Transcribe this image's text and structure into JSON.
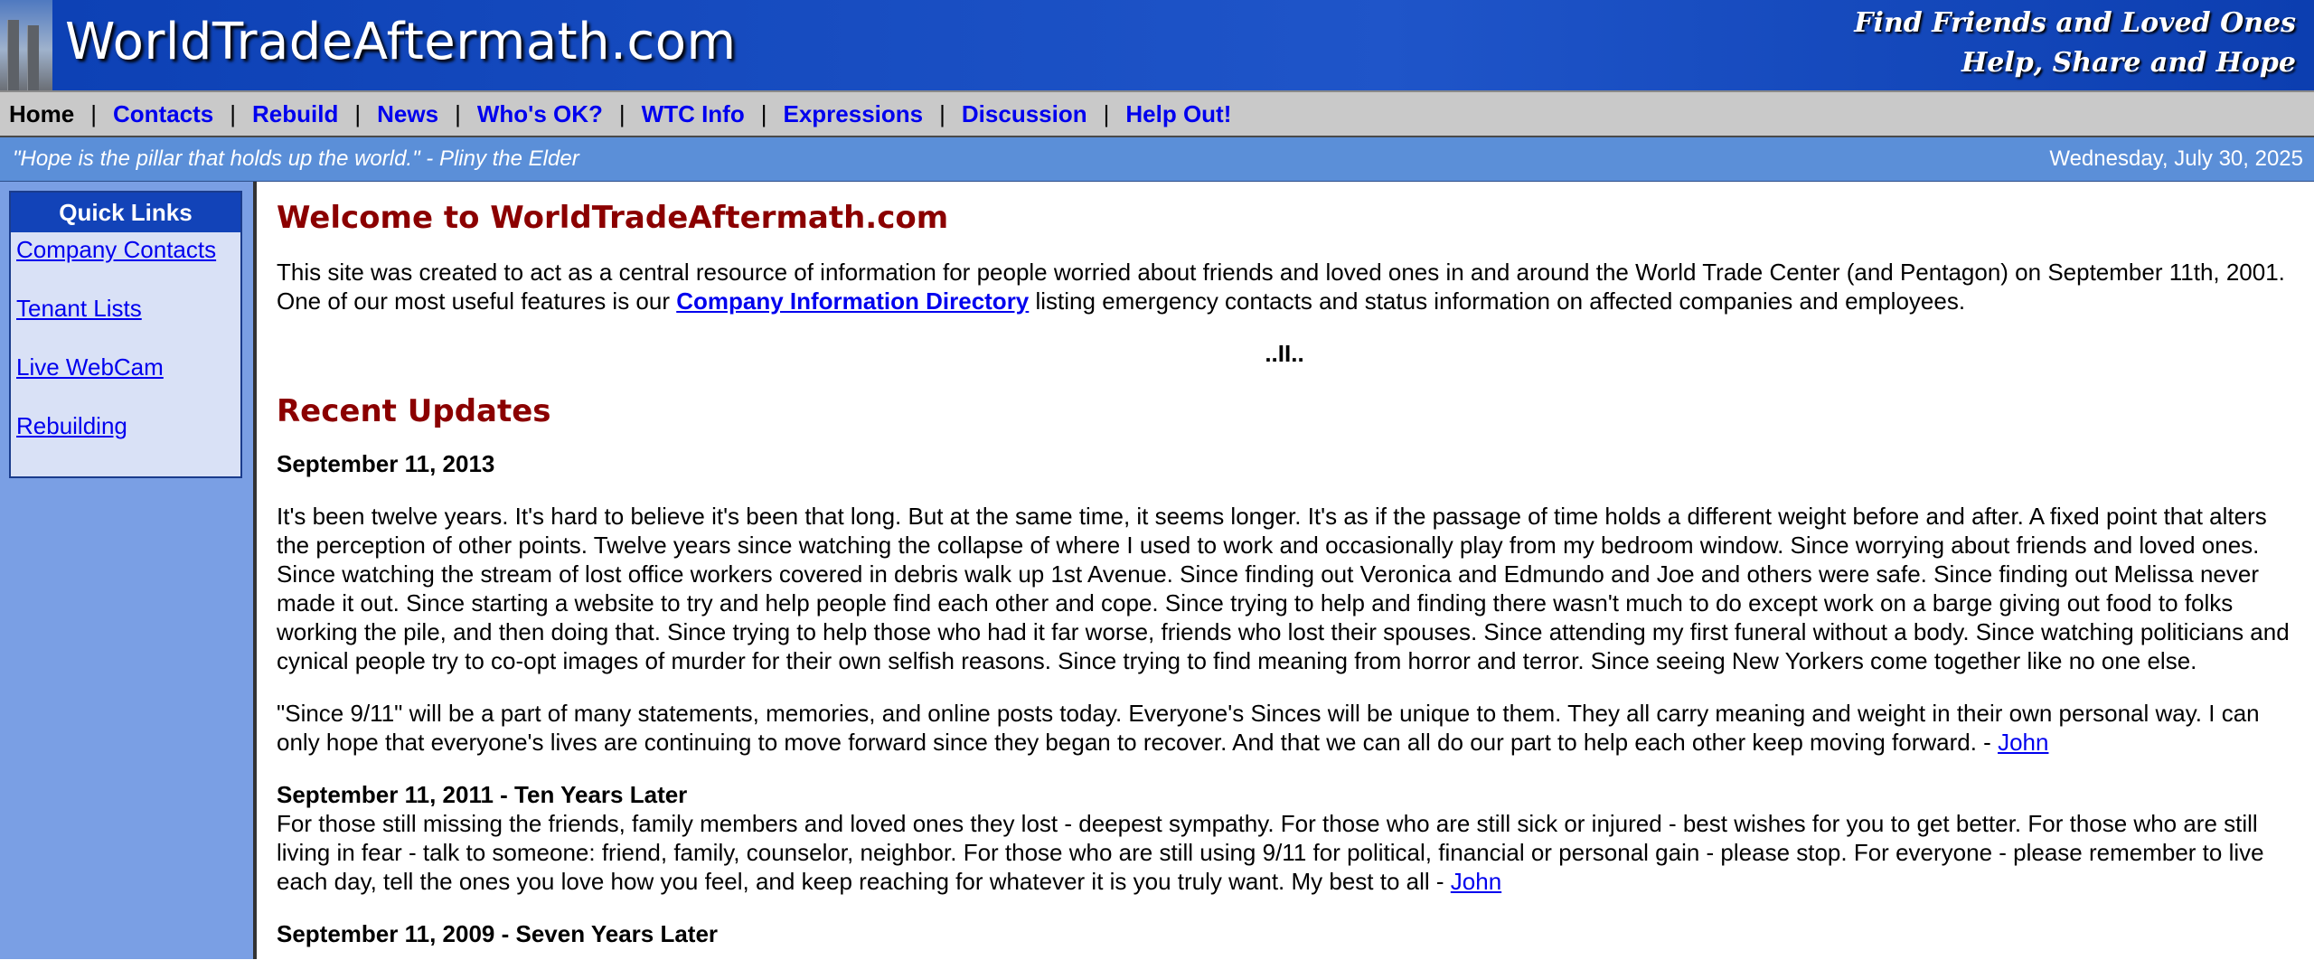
{
  "header": {
    "logo_text": "WorldTradeAftermath.com",
    "tagline_line1": "Find Friends and Loved Ones",
    "tagline_line2": "Help, Share and Hope"
  },
  "nav": {
    "items": [
      {
        "label": "Home"
      },
      {
        "label": "Contacts"
      },
      {
        "label": "Rebuild"
      },
      {
        "label": "News"
      },
      {
        "label": "Who's OK?"
      },
      {
        "label": "WTC Info"
      },
      {
        "label": "Expressions"
      },
      {
        "label": "Discussion"
      },
      {
        "label": "Help Out!"
      }
    ],
    "separator": "|"
  },
  "quotebar": {
    "quote": "\"Hope is the pillar that holds up the world.\" - Pliny the Elder",
    "date": "Wednesday, July 30, 2025"
  },
  "sidebar": {
    "title": "Quick Links",
    "links": [
      {
        "label": "Company Contacts"
      },
      {
        "label": "Tenant Lists"
      },
      {
        "label": "Live WebCam"
      },
      {
        "label": "Rebuilding"
      }
    ]
  },
  "main": {
    "welcome_title": "Welcome to WorldTradeAftermath.com",
    "intro_before": "This site was created to act as a central resource of information for people worried about friends and loved ones in and around the World Trade Center (and Pentagon) on September 11th, 2001. One of our most useful features is our ",
    "intro_link": "Company Information Directory",
    "intro_after": " listing emergency contacts and status information on affected companies and employees.",
    "divider": "..II..",
    "updates_title": "Recent Updates",
    "update1": {
      "date": "September 11, 2013",
      "para1": "It's been twelve years. It's hard to believe it's been that long. But at the same time, it seems longer. It's as if the passage of time holds a different weight before and after. A fixed point that alters the perception of other points. Twelve years since watching the collapse of where I used to work and occasionally play from my bedroom window. Since worrying about friends and loved ones. Since watching the stream of lost office workers covered in debris walk up 1st Avenue. Since finding out Veronica and Edmundo and Joe and others were safe. Since finding out Melissa never made it out. Since starting a website to try and help people find each other and cope. Since trying to help and finding there wasn't much to do except work on a barge giving out food to folks working the pile, and then doing that. Since trying to help those who had it far worse, friends who lost their spouses. Since attending my first funeral without a body. Since watching politicians and cynical people try to co-opt images of murder for their own selfish reasons. Since trying to find meaning from horror and terror. Since seeing New Yorkers come together like no one else.",
      "para2": "\"Since 9/11\" will be a part of many statements, memories, and online posts today. Everyone's Sinces will be unique to them. They all carry meaning and weight in their own personal way. I can only hope that everyone's lives are continuing to move forward since they began to recover. And that we can all do our part to help each other keep moving forward. - ",
      "author": "John"
    },
    "update2": {
      "date": "September 11, 2011 - Ten Years Later",
      "para1": "For those still missing the friends, family members and loved ones they lost - deepest sympathy. For those who are still sick or injured - best wishes for you to get better. For those who are still living in fear - talk to someone: friend, family, counselor, neighbor. For those who are still using 9/11 for political, financial or personal gain - please stop. For everyone - please remember to live each day, tell the ones you love how you feel, and keep reaching for whatever it is you truly want. My best to all - ",
      "author": "John"
    },
    "update3": {
      "date": "September 11, 2009 - Seven Years Later"
    }
  }
}
